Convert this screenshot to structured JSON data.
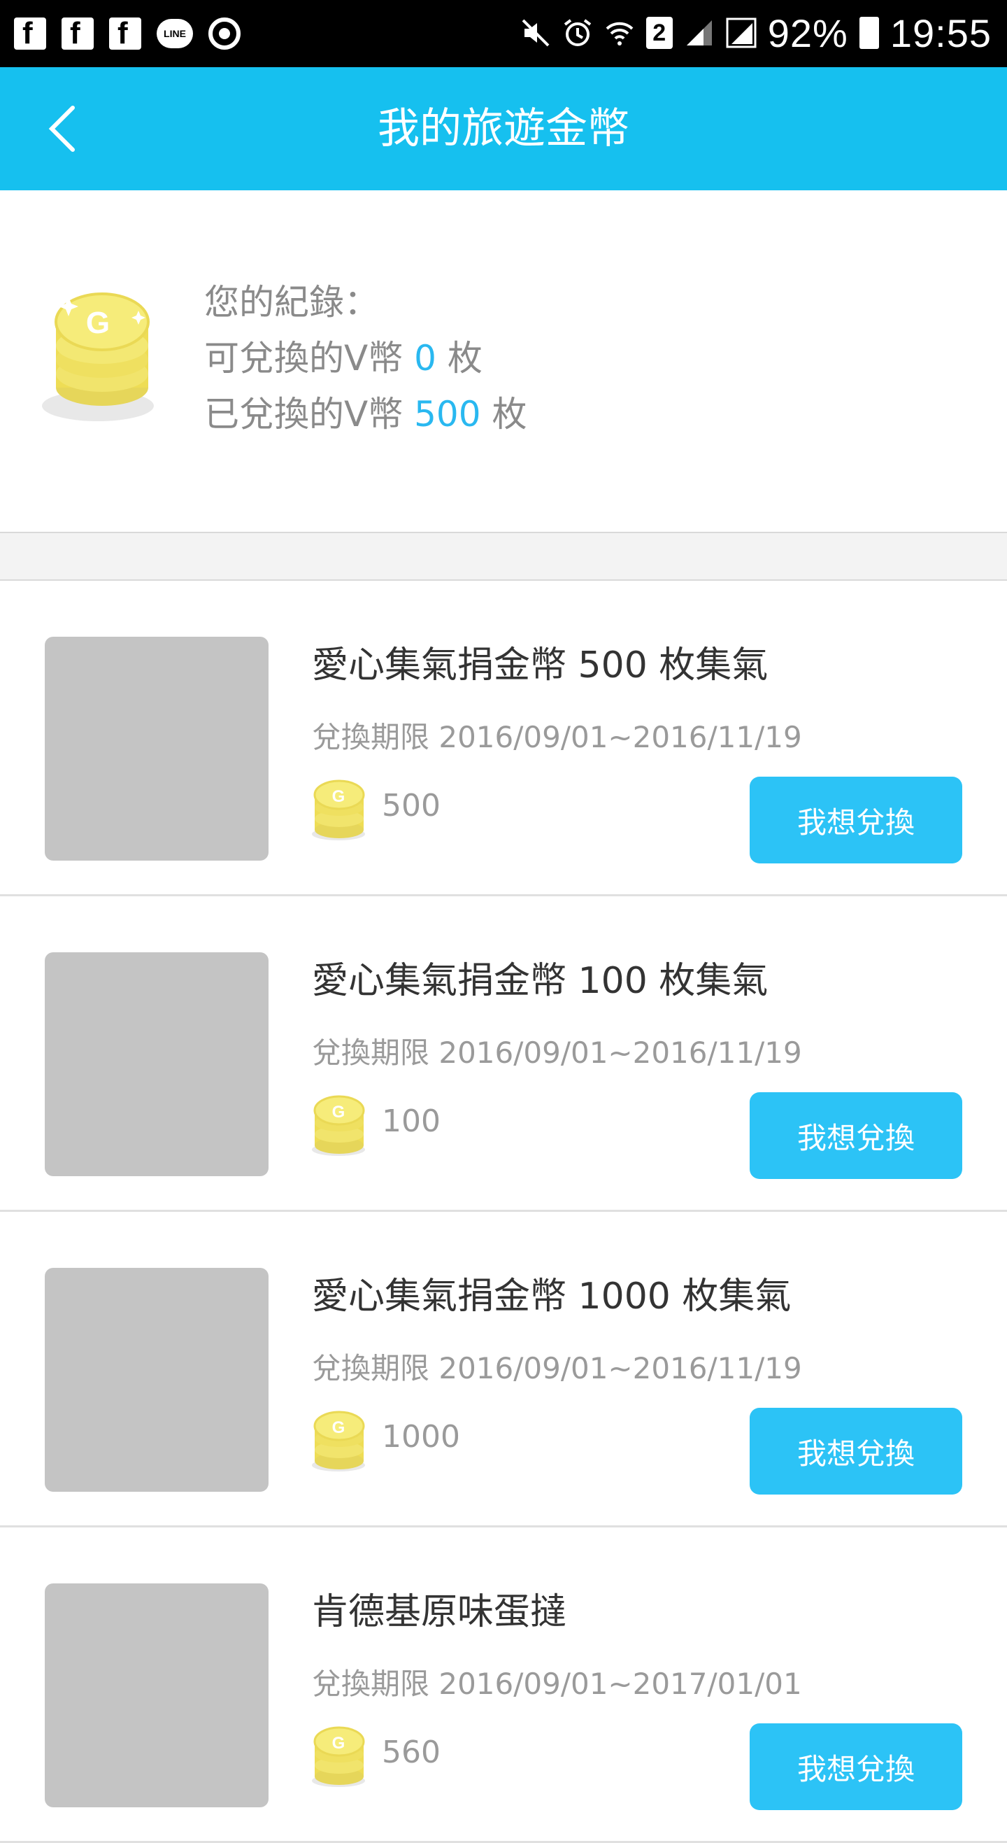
{
  "status_bar": {
    "battery_percent": "92%",
    "time": "19:55",
    "sim_slot": "2",
    "notification_icons": [
      "facebook-icon",
      "facebook-icon",
      "facebook-icon",
      "line-icon",
      "chrome-icon"
    ],
    "line_label": "LINE"
  },
  "header": {
    "title": "我的旅遊金幣",
    "back_icon": "chevron-left-icon",
    "background": "#16c0ef"
  },
  "summary": {
    "heading": "您的紀錄：",
    "available_label": "可兌換的V幣",
    "available_value": "0",
    "redeemed_label": "已兌換的V幣",
    "redeemed_value": "500",
    "unit": "枚",
    "accent_color": "#29b8f0"
  },
  "items": [
    {
      "title": "愛心集氣捐金幣 500 枚集氣",
      "period": "兌換期限 2016/09/01~2016/11/19",
      "price": "500",
      "button": "我想兌換"
    },
    {
      "title": "愛心集氣捐金幣 100 枚集氣",
      "period": "兌換期限 2016/09/01~2016/11/19",
      "price": "100",
      "button": "我想兌換"
    },
    {
      "title": "愛心集氣捐金幣 1000 枚集氣",
      "period": "兌換期限 2016/09/01~2016/11/19",
      "price": "1000",
      "button": "我想兌換"
    },
    {
      "title": "肯德基原味蛋撻",
      "period": "兌換期限 2016/09/01~2017/01/01",
      "price": "560",
      "button": "我想兌換"
    }
  ]
}
